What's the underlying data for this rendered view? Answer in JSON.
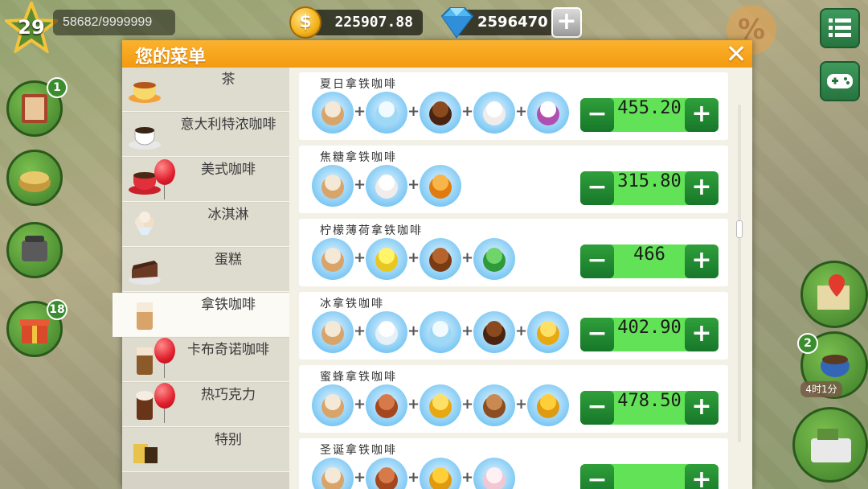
{
  "hud": {
    "level": "29",
    "xp": "58682/9999999",
    "coins": "225907.88",
    "coin_symbol": "$",
    "gems": "2596470",
    "add_symbol": "+",
    "sale_symbol": "%",
    "left_badges": [
      "1",
      "18"
    ],
    "right_badge": "2",
    "timer": "4时1分"
  },
  "dialog": {
    "title": "您的菜单",
    "close_symbol": "✕"
  },
  "categories": [
    {
      "label": "茶",
      "icon": "tea-cup-icon"
    },
    {
      "label": "意大利特浓咖啡",
      "icon": "espresso-cup-icon"
    },
    {
      "label": "美式咖啡",
      "icon": "americano-cup-icon"
    },
    {
      "label": "冰淇淋",
      "icon": "ice-cream-icon"
    },
    {
      "label": "蛋糕",
      "icon": "cake-icon"
    },
    {
      "label": "拿铁咖啡",
      "icon": "latte-glass-icon"
    },
    {
      "label": "卡布奇诺咖啡",
      "icon": "cappuccino-glass-icon"
    },
    {
      "label": "热巧克力",
      "icon": "hot-chocolate-icon"
    },
    {
      "label": "特别",
      "icon": "special-drink-icon"
    }
  ],
  "plus_symbol": "+",
  "minus_symbol": "−",
  "recipes": [
    {
      "name": "夏日拿铁咖啡",
      "price": "455.20",
      "ingredients": [
        "latte-icon",
        "ice-cubes-icon",
        "chocolate-syrup-icon",
        "whipped-cream-icon",
        "grape-juice-carton-icon"
      ]
    },
    {
      "name": "焦糖拿铁咖啡",
      "price": "315.80",
      "ingredients": [
        "latte-icon",
        "whipped-cream-icon",
        "caramel-drop-icon"
      ]
    },
    {
      "name": "柠檬薄荷拿铁咖啡",
      "price": "466",
      "ingredients": [
        "latte-icon",
        "lemon-slice-icon",
        "chocolate-bar-icon",
        "mint-leaves-icon"
      ]
    },
    {
      "name": "冰拿铁咖啡",
      "price": "402.90",
      "ingredients": [
        "latte-icon",
        "milk-jug-icon",
        "ice-cubes-icon",
        "chocolate-syrup-icon",
        "honey-drop-icon"
      ]
    },
    {
      "name": "蜜蜂拿铁咖啡",
      "price": "478.50",
      "ingredients": [
        "latte-icon",
        "cinnamon-sticks-icon",
        "honey-drop-icon",
        "hazelnut-icon",
        "honeycomb-icon"
      ]
    },
    {
      "name": "圣诞拿铁咖啡",
      "price": "",
      "ingredients": [
        "latte-icon",
        "cinnamon-sticks-icon",
        "honeycomb-icon",
        "marshmallow-icon"
      ]
    }
  ],
  "colors": {
    "header_orange": "#f39a10",
    "price_green": "#62e257",
    "button_green": "#17772a",
    "balloon_red": "#e01f2d"
  }
}
